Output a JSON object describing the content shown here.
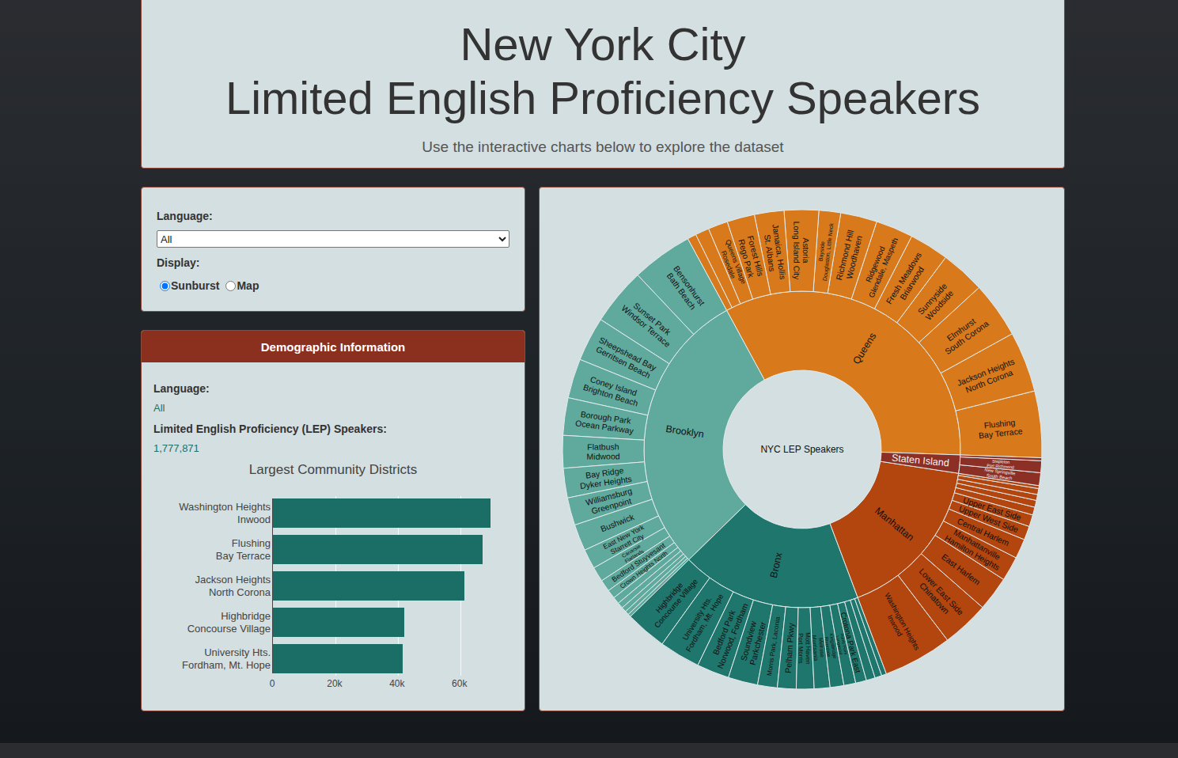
{
  "header": {
    "title_lines": [
      "New York City",
      "Limited English Proficiency Speakers"
    ],
    "subtitle": "Use the interactive charts below to explore the dataset"
  },
  "controls": {
    "language_label": "Language:",
    "language_value": "All",
    "display_label": "Display:",
    "display_options": [
      {
        "label": "Sunburst",
        "selected": true
      },
      {
        "label": "Map",
        "selected": false
      }
    ]
  },
  "demographics": {
    "title": "Demographic Information",
    "fields": [
      {
        "label": "Language:",
        "value": "All"
      },
      {
        "label": "Limited English Proficiency (LEP) Speakers:",
        "value": "1,777,871"
      }
    ],
    "chart": {
      "title": "Largest Community Districts",
      "bars": [
        {
          "lines": [
            "Washington Heights",
            "Inwood"
          ],
          "value": 69600
        },
        {
          "lines": [
            "Flushing",
            "Bay Terrace"
          ],
          "value": 67100
        },
        {
          "lines": [
            "Jackson Heights",
            "North Corona"
          ],
          "value": 61300
        },
        {
          "lines": [
            "Highbridge",
            "Concourse Village"
          ],
          "value": 42000
        },
        {
          "lines": [
            "University Hts.",
            "Fordham, Mt. Hope"
          ],
          "value": 41500
        }
      ],
      "ticks": [
        {
          "label": "0",
          "value": 0
        },
        {
          "label": "20k",
          "value": 20000
        },
        {
          "label": "40k",
          "value": 40000
        },
        {
          "label": "60k",
          "value": 60000
        }
      ]
    }
  },
  "sunburst": {
    "center_label": "NYC LEP Speakers",
    "boroughs": [
      {
        "name": "Queens",
        "color": "#d8791b",
        "districts": [
          {
            "lines": [
              "Flushing",
              "Bay Terrace"
            ],
            "value": 67500
          },
          {
            "lines": [
              "Jackson Heights",
              "North Corona"
            ],
            "value": 61500
          },
          {
            "lines": [
              "Elmhurst",
              "South Corona"
            ],
            "value": 57000
          },
          {
            "lines": [
              "Sunnyside",
              "Woodside"
            ],
            "value": 45000
          },
          {
            "lines": [
              "Fresh Meadows",
              "Briarwood"
            ],
            "value": 40000
          },
          {
            "lines": [
              "Ridgewood",
              "Glendale, Maspeth"
            ],
            "value": 38000
          },
          {
            "lines": [
              "Richmond Hill",
              "Woodhaven"
            ],
            "value": 37000
          },
          {
            "lines": [
              "Bayside",
              "Douglaston, Little Neck"
            ],
            "value": 22000
          },
          {
            "lines": [
              "Astoria",
              "Long Island City"
            ],
            "value": 35000
          },
          {
            "lines": [
              "Jamaica, Hollis",
              "St. Albans"
            ],
            "value": 30000
          },
          {
            "lines": [
              "Forest Hills",
              "Rego Park"
            ],
            "value": 28000
          },
          {
            "lines": [
              "Queens Village",
              "Rosedale"
            ],
            "value": 20000
          },
          {
            "lines": [],
            "value": 14000
          },
          {
            "lines": [],
            "value": 9000
          }
        ]
      },
      {
        "name": "Brooklyn",
        "color": "#5fa99d",
        "districts": [
          {
            "lines": [
              "Bensonhurst",
              "Bath Beach"
            ],
            "value": 62000
          },
          {
            "lines": [
              "Sunset Park",
              "Windsor Terrace"
            ],
            "value": 58000
          },
          {
            "lines": [
              "Sheepshead Bay",
              "Gerritsen Beach"
            ],
            "value": 45000
          },
          {
            "lines": [
              "Coney Island",
              "Brighton Beach"
            ],
            "value": 40000
          },
          {
            "lines": [
              "Borough Park",
              "Ocean Parkway"
            ],
            "value": 38000
          },
          {
            "lines": [
              "Flatbush",
              "Midwood"
            ],
            "value": 33000
          },
          {
            "lines": [
              "Bay Ridge",
              "Dyker Heights"
            ],
            "value": 30000
          },
          {
            "lines": [
              "Williamsburg",
              "Greenpoint"
            ],
            "value": 28000
          },
          {
            "lines": [
              "Bushwick"
            ],
            "value": 27000
          },
          {
            "lines": [
              "East New York",
              "Starrett City"
            ],
            "value": 20000
          },
          {
            "lines": [
              "Canarsie",
              "Flatlands"
            ],
            "value": 15000
          },
          {
            "lines": [
              "Bedford Stuyvesant"
            ],
            "value": 12000
          },
          {
            "lines": [
              "Crown Heights North"
            ],
            "value": 9000
          },
          {
            "lines": [],
            "value": 7000
          },
          {
            "lines": [],
            "value": 6000
          },
          {
            "lines": [],
            "value": 5000
          },
          {
            "lines": [],
            "value": 4000
          },
          {
            "lines": [],
            "value": 3000
          }
        ]
      },
      {
        "name": "Bronx",
        "color": "#1f766c",
        "districts": [
          {
            "lines": [
              "Highbridge",
              "Concourse Village"
            ],
            "value": 42000
          },
          {
            "lines": [
              "University Hts.",
              "Fordham, Mt. Hope"
            ],
            "value": 41500
          },
          {
            "lines": [
              "Bedford Park",
              "Norwood, Fordham"
            ],
            "value": 33000
          },
          {
            "lines": [
              "Soundview",
              "Parkchester"
            ],
            "value": 30000
          },
          {
            "lines": [
              "Morris Park, Laconia"
            ],
            "value": 20000
          },
          {
            "lines": [
              "Pelham Pkwy"
            ],
            "value": 19000
          },
          {
            "lines": [
              "Mott Haven",
              "Port Morris"
            ],
            "value": 18000
          },
          {
            "lines": [
              "Melrose",
              "Morrisania"
            ],
            "value": 16000
          },
          {
            "lines": [
              "Kingsbridge",
              "Riverdale"
            ],
            "value": 14000
          },
          {
            "lines": [
              "Hunts Point",
              "Longwood"
            ],
            "value": 12000
          },
          {
            "lines": [
              "Crotona Park East"
            ],
            "value": 11000
          },
          {
            "lines": [],
            "value": 9000
          },
          {
            "lines": [],
            "value": 7000
          },
          {
            "lines": [],
            "value": 5000
          }
        ]
      },
      {
        "name": "Manhattan",
        "color": "#b3450e",
        "districts": [
          {
            "lines": [
              "Washington Heights",
              "Inwood"
            ],
            "value": 70000
          },
          {
            "lines": [
              "Lower East Side",
              "Chinatown"
            ],
            "value": 48000
          },
          {
            "lines": [
              "East Harlem"
            ],
            "value": 35000
          },
          {
            "lines": [
              "Manhattanville",
              "Hamilton Heights"
            ],
            "value": 25000
          },
          {
            "lines": [
              "Central Harlem"
            ],
            "value": 20000
          },
          {
            "lines": [
              "Upper West Side"
            ],
            "value": 14000
          },
          {
            "lines": [
              "Upper East Side"
            ],
            "value": 12000
          },
          {
            "lines": [],
            "value": 8000
          },
          {
            "lines": [],
            "value": 7000
          },
          {
            "lines": [],
            "value": 6000
          },
          {
            "lines": [],
            "value": 6000
          },
          {
            "lines": [],
            "value": 3000
          }
        ]
      },
      {
        "name": "Staten Island",
        "color": "#8c2f25",
        "districts": [
          {
            "lines": [
              "New Springville",
              "South Beach"
            ],
            "value": 13000
          },
          {
            "lines": [
              "Stapleton",
              "Port Richmond"
            ],
            "value": 12000
          },
          {
            "lines": [],
            "value": 3000
          }
        ]
      }
    ]
  }
}
